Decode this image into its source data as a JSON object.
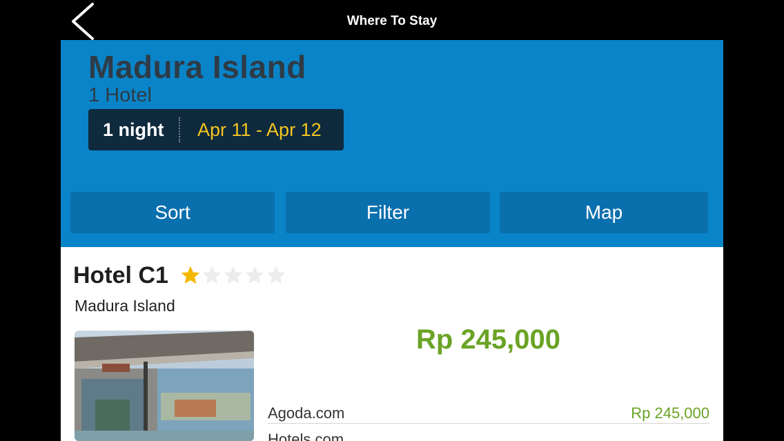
{
  "topbar": {
    "title": "Where To Stay",
    "back_icon": "chevron-left-icon"
  },
  "header": {
    "destination": "Madura Island",
    "hotel_count": "1 Hotel",
    "nights": "1 night",
    "dates": "Apr 11 - Apr 12",
    "colors": {
      "header_bg": "#0a84c8",
      "button_bg": "#0a6fad",
      "dates_text": "#f5c521"
    }
  },
  "actions": {
    "sort": "Sort",
    "filter": "Filter",
    "map": "Map"
  },
  "hotel": {
    "name": "Hotel C1",
    "rating": 1,
    "max_rating": 5,
    "location": "Madura Island",
    "price": "Rp 245,000",
    "price_color": "#6aa325",
    "providers": [
      {
        "name": "Agoda.com",
        "price": "Rp 245,000"
      },
      {
        "name": "Hotels.com",
        "price": ""
      }
    ]
  }
}
